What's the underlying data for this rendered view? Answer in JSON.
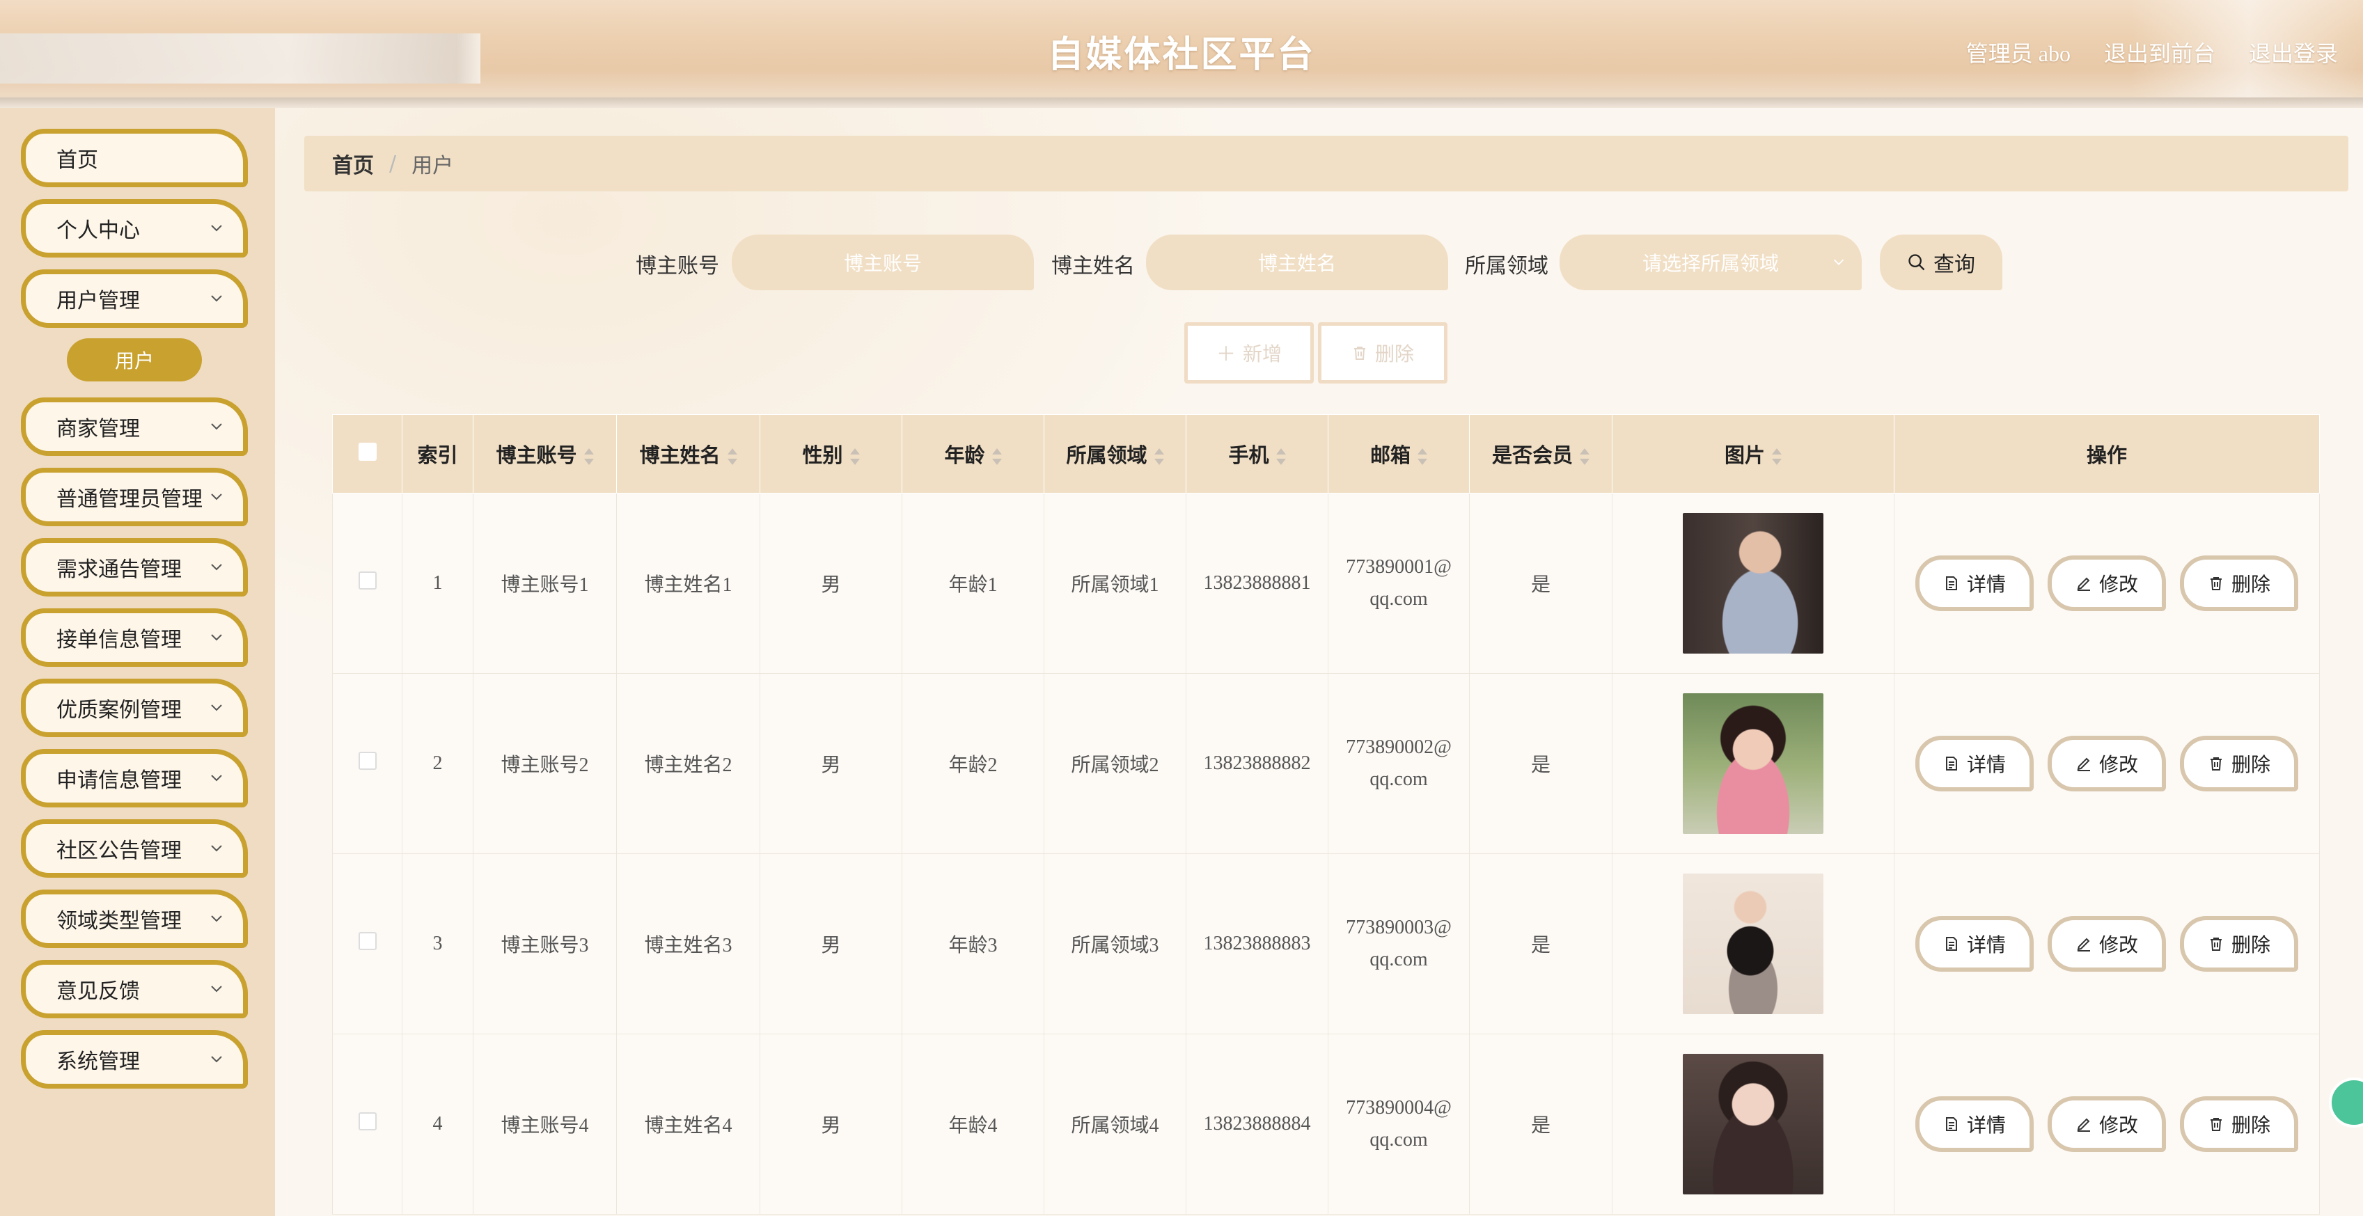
{
  "header": {
    "title": "自媒体社区平台",
    "admin_label": "管理员 abo",
    "exit_front_label": "退出到前台",
    "logout_label": "退出登录"
  },
  "sidebar": {
    "items": [
      {
        "label": "首页"
      },
      {
        "label": "个人中心"
      },
      {
        "label": "用户管理"
      },
      {
        "label": "商家管理"
      },
      {
        "label": "普通管理员管理"
      },
      {
        "label": "需求通告管理"
      },
      {
        "label": "接单信息管理"
      },
      {
        "label": "优质案例管理"
      },
      {
        "label": "申请信息管理"
      },
      {
        "label": "社区公告管理"
      },
      {
        "label": "领域类型管理"
      },
      {
        "label": "意见反馈"
      },
      {
        "label": "系统管理"
      }
    ],
    "active_sub": "用户"
  },
  "breadcrumb": {
    "home": "首页",
    "sep": "/",
    "current": "用户"
  },
  "search": {
    "account_label": "博主账号",
    "account_placeholder": "博主账号",
    "name_label": "博主姓名",
    "name_placeholder": "博主姓名",
    "field_label": "所属领域",
    "field_placeholder": "请选择所属领域",
    "query_label": "查询"
  },
  "actions": {
    "add_label": "新增",
    "delete_label": "删除"
  },
  "table": {
    "headers": [
      "索引",
      "博主账号",
      "博主姓名",
      "性别",
      "年龄",
      "所属领域",
      "手机",
      "邮箱",
      "是否会员",
      "图片",
      "操作"
    ],
    "rows": [
      {
        "index": "1",
        "account": "博主账号1",
        "name": "博主姓名1",
        "gender": "男",
        "age": "年龄1",
        "field": "所属领域1",
        "phone": "13823888881",
        "email_a": "773890001@",
        "email_b": "qq.com",
        "member": "是"
      },
      {
        "index": "2",
        "account": "博主账号2",
        "name": "博主姓名2",
        "gender": "男",
        "age": "年龄2",
        "field": "所属领域2",
        "phone": "13823888882",
        "email_a": "773890002@",
        "email_b": "qq.com",
        "member": "是"
      },
      {
        "index": "3",
        "account": "博主账号3",
        "name": "博主姓名3",
        "gender": "男",
        "age": "年龄3",
        "field": "所属领域3",
        "phone": "13823888883",
        "email_a": "773890003@",
        "email_b": "qq.com",
        "member": "是"
      },
      {
        "index": "4",
        "account": "博主账号4",
        "name": "博主姓名4",
        "gender": "男",
        "age": "年龄4",
        "field": "所属领域4",
        "phone": "13823888884",
        "email_a": "773890004@",
        "email_b": "qq.com",
        "member": "是"
      }
    ],
    "row_ops": {
      "detail": "详情",
      "edit": "修改",
      "delete": "删除"
    }
  },
  "colors": {
    "accent": "#c9a12f",
    "header_bg": "#f1dfc5",
    "sidebar_bg": "#efdcc2"
  }
}
